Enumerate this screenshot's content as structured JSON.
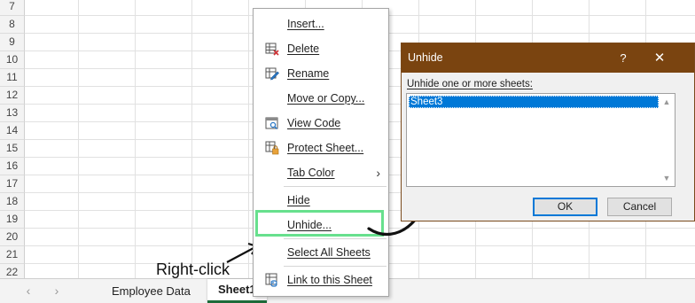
{
  "sheet": {
    "row_numbers": [
      "7",
      "8",
      "9",
      "10",
      "11",
      "12",
      "13",
      "14",
      "15",
      "16",
      "17",
      "18",
      "19",
      "20",
      "21",
      "22"
    ]
  },
  "tabs": {
    "prev_arrow": "‹",
    "next_arrow": "›",
    "items": [
      {
        "label": "Employee Data",
        "active": false
      },
      {
        "label": "Sheet1",
        "active": true
      }
    ]
  },
  "context_menu": {
    "items": [
      {
        "label": "Insert...",
        "icon": "none"
      },
      {
        "label": "Delete",
        "icon": "delete-sheet-icon"
      },
      {
        "label": "Rename",
        "icon": "rename-sheet-icon"
      },
      {
        "label": "Move or Copy...",
        "icon": "none"
      },
      {
        "label": "View Code",
        "icon": "view-code-icon"
      },
      {
        "label": "Protect Sheet...",
        "icon": "protect-sheet-icon"
      },
      {
        "label": "Tab Color",
        "icon": "none",
        "submenu": true
      },
      {
        "label": "Hide",
        "icon": "none"
      },
      {
        "label": "Unhide...",
        "icon": "none",
        "highlighted": true
      },
      {
        "label": "Select All Sheets",
        "icon": "none"
      },
      {
        "label": "Link to this Sheet",
        "icon": "link-sheet-icon"
      }
    ],
    "submenu_arrow": "›"
  },
  "annotation": {
    "label": "Right-click",
    "highlight_color": "#67e08d"
  },
  "dialog": {
    "title": "Unhide",
    "help": "?",
    "close": "✕",
    "prompt": "Unhide one or more sheets:",
    "sheets": [
      "Sheet3"
    ],
    "ok_label": "OK",
    "cancel_label": "Cancel",
    "titlebar_color": "#7a4410"
  }
}
